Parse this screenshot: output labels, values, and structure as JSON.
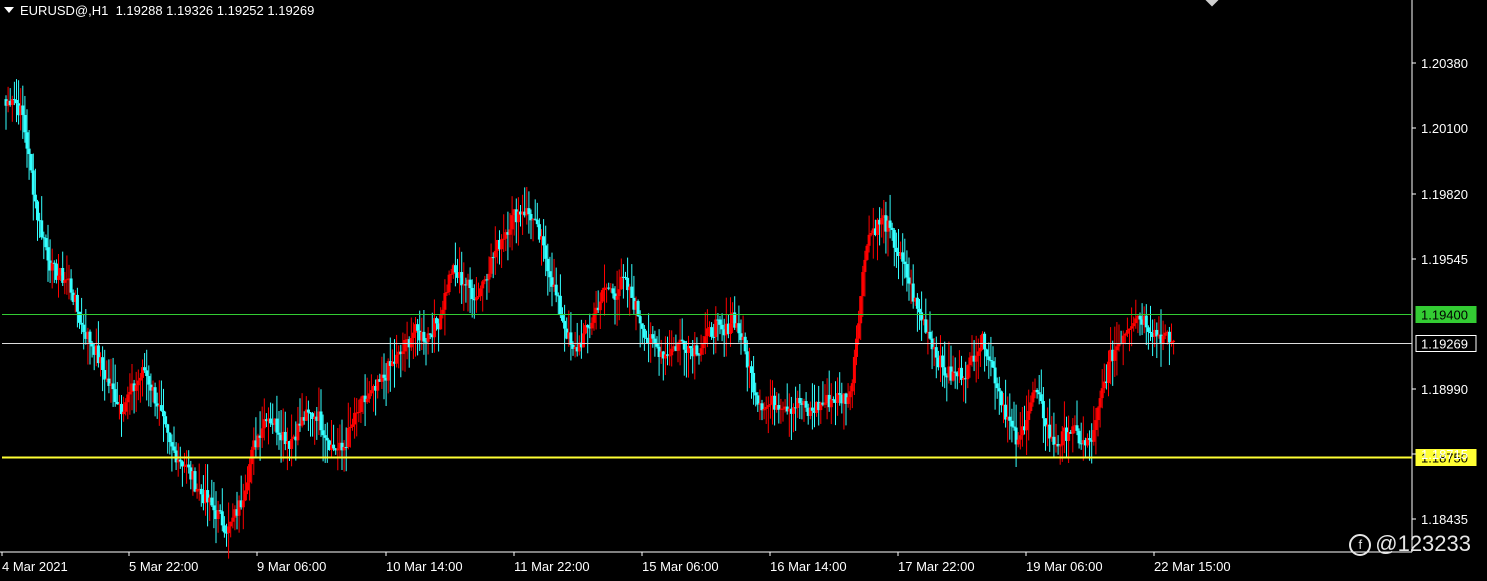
{
  "header": {
    "symbol": "EURUSD@,H1",
    "ohlc": "1.19288 1.19326 1.19252 1.19269"
  },
  "watermark": "@123233",
  "colors": {
    "background": "#000000",
    "bull": "#ff0000",
    "bear": "#33ffff",
    "green_line": "#33cc33",
    "yellow_line": "#ffff33",
    "price_line": "#dddddd",
    "axis": "#ffffff"
  },
  "chart_data": {
    "type": "candlestick",
    "title": "EURUSD@,H1",
    "ylim": [
      1.1832,
      1.2083
    ],
    "y_ticks": [
      "1.20380",
      "1.20100",
      "1.19820",
      "1.19545",
      "1.18990",
      "1.18715",
      "1.18435"
    ],
    "x_ticks": [
      "4 Mar 2021",
      "5 Mar 22:00",
      "9 Mar 06:00",
      "10 Mar 14:00",
      "11 Mar 22:00",
      "15 Mar 06:00",
      "16 Mar 14:00",
      "17 Mar 22:00",
      "19 Mar 06:00",
      "22 Mar 15:00"
    ],
    "horizontal_lines": [
      {
        "name": "green-level",
        "value": 1.194,
        "label": "1.19400",
        "color": "#33cc33"
      },
      {
        "name": "current-price",
        "value": 1.19269,
        "label": "1.19269",
        "color": "#dddddd"
      },
      {
        "name": "yellow-level",
        "value": 1.1875,
        "label": "1.18750",
        "color": "#ffff33"
      }
    ],
    "close_path": [
      [
        0,
        1.2035
      ],
      [
        3,
        1.204
      ],
      [
        8,
        1.203
      ],
      [
        15,
        1.1985
      ],
      [
        22,
        1.196
      ],
      [
        30,
        1.1955
      ],
      [
        36,
        1.1935
      ],
      [
        42,
        1.1925
      ],
      [
        48,
        1.191
      ],
      [
        55,
        1.1898
      ],
      [
        60,
        1.1905
      ],
      [
        66,
        1.1915
      ],
      [
        72,
        1.19
      ],
      [
        78,
        1.188
      ],
      [
        85,
        1.1872
      ],
      [
        92,
        1.186
      ],
      [
        100,
        1.185
      ],
      [
        106,
        1.1842
      ],
      [
        112,
        1.1855
      ],
      [
        118,
        1.188
      ],
      [
        124,
        1.1895
      ],
      [
        130,
        1.1888
      ],
      [
        135,
        1.1882
      ],
      [
        142,
        1.1893
      ],
      [
        148,
        1.1895
      ],
      [
        155,
        1.188
      ],
      [
        160,
        1.1878
      ],
      [
        165,
        1.189
      ],
      [
        170,
        1.19
      ],
      [
        176,
        1.1905
      ],
      [
        182,
        1.1915
      ],
      [
        188,
        1.1922
      ],
      [
        194,
        1.1932
      ],
      [
        200,
        1.193
      ],
      [
        206,
        1.1937
      ],
      [
        212,
        1.196
      ],
      [
        218,
        1.1955
      ],
      [
        224,
        1.1948
      ],
      [
        230,
        1.1962
      ],
      [
        236,
        1.1975
      ],
      [
        242,
        1.1985
      ],
      [
        246,
        1.1988
      ],
      [
        250,
        1.1985
      ],
      [
        254,
        1.1975
      ],
      [
        258,
        1.1963
      ],
      [
        262,
        1.1948
      ],
      [
        266,
        1.1935
      ],
      [
        270,
        1.1922
      ],
      [
        274,
        1.1928
      ],
      [
        278,
        1.1935
      ],
      [
        282,
        1.1945
      ],
      [
        286,
        1.1952
      ],
      [
        290,
        1.195
      ],
      [
        294,
        1.1955
      ],
      [
        298,
        1.1948
      ],
      [
        302,
        1.1938
      ],
      [
        306,
        1.1928
      ],
      [
        310,
        1.1925
      ],
      [
        314,
        1.1922
      ],
      [
        318,
        1.1925
      ],
      [
        322,
        1.1928
      ],
      [
        326,
        1.1925
      ],
      [
        330,
        1.1925
      ],
      [
        334,
        1.193
      ],
      [
        338,
        1.1935
      ],
      [
        342,
        1.193
      ],
      [
        346,
        1.194
      ],
      [
        350,
        1.193
      ],
      [
        354,
        1.1915
      ],
      [
        358,
        1.1902
      ],
      [
        362,
        1.1898
      ],
      [
        366,
        1.19
      ],
      [
        370,
        1.19
      ],
      [
        374,
        1.1898
      ],
      [
        378,
        1.19
      ],
      [
        382,
        1.1895
      ],
      [
        386,
        1.1898
      ],
      [
        390,
        1.19
      ],
      [
        394,
        1.1902
      ],
      [
        398,
        1.1902
      ],
      [
        402,
        1.1903
      ],
      [
        406,
        1.194
      ],
      [
        410,
        1.1975
      ],
      [
        414,
        1.198
      ],
      [
        418,
        1.1983
      ],
      [
        422,
        1.1975
      ],
      [
        426,
        1.1965
      ],
      [
        430,
        1.1955
      ],
      [
        434,
        1.1942
      ],
      [
        438,
        1.1935
      ],
      [
        442,
        1.1925
      ],
      [
        446,
        1.1915
      ],
      [
        450,
        1.1912
      ],
      [
        454,
        1.1913
      ],
      [
        458,
        1.1915
      ],
      [
        462,
        1.1925
      ],
      [
        466,
        1.1928
      ],
      [
        470,
        1.1915
      ],
      [
        474,
        1.1902
      ],
      [
        478,
        1.189
      ],
      [
        482,
        1.188
      ],
      [
        486,
        1.1895
      ],
      [
        490,
        1.1905
      ],
      [
        494,
        1.1895
      ],
      [
        498,
        1.1882
      ],
      [
        502,
        1.1882
      ],
      [
        506,
        1.1888
      ],
      [
        510,
        1.1885
      ],
      [
        514,
        1.188
      ],
      [
        518,
        1.1885
      ],
      [
        522,
        1.1905
      ],
      [
        526,
        1.192
      ],
      [
        530,
        1.1928
      ],
      [
        534,
        1.1935
      ],
      [
        538,
        1.194
      ],
      [
        542,
        1.1938
      ],
      [
        546,
        1.1933
      ],
      [
        550,
        1.193
      ],
      [
        554,
        1.1928
      ],
      [
        556,
        1.1927
      ]
    ]
  }
}
